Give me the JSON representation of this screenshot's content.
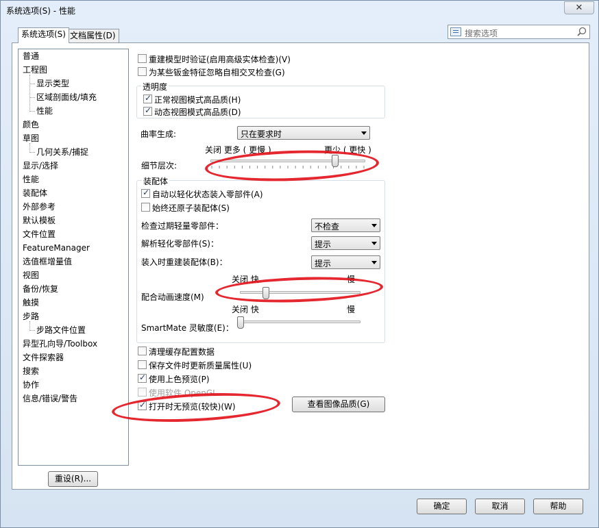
{
  "window": {
    "title": "系统选项(S) - 性能",
    "close": "✕"
  },
  "tabs": {
    "system": "系统选项(S)",
    "document": "文档属性(D)"
  },
  "search": {
    "placeholder": "搜索选项"
  },
  "tree": {
    "items": [
      {
        "label": "普通",
        "level": 0
      },
      {
        "label": "工程图",
        "level": 0
      },
      {
        "label": "显示类型",
        "level": 1
      },
      {
        "label": "区域剖面线/填充",
        "level": 1
      },
      {
        "label": "性能",
        "level": 1
      },
      {
        "label": "颜色",
        "level": 0
      },
      {
        "label": "草图",
        "level": 0
      },
      {
        "label": "几何关系/捕捉",
        "level": 1
      },
      {
        "label": "显示/选择",
        "level": 0
      },
      {
        "label": "性能",
        "level": 0
      },
      {
        "label": "装配体",
        "level": 0
      },
      {
        "label": "外部参考",
        "level": 0
      },
      {
        "label": "默认模板",
        "level": 0
      },
      {
        "label": "文件位置",
        "level": 0
      },
      {
        "label": "FeatureManager",
        "level": 0
      },
      {
        "label": "选值框增量值",
        "level": 0
      },
      {
        "label": "视图",
        "level": 0
      },
      {
        "label": "备份/恢复",
        "level": 0
      },
      {
        "label": "触摸",
        "level": 0
      },
      {
        "label": "步路",
        "level": 0
      },
      {
        "label": "步路文件位置",
        "level": 1
      },
      {
        "label": "异型孔向导/Toolbox",
        "level": 0
      },
      {
        "label": "文件探索器",
        "level": 0
      },
      {
        "label": "搜索",
        "level": 0
      },
      {
        "label": "协作",
        "level": 0
      },
      {
        "label": "信息/错误/警告",
        "level": 0
      }
    ]
  },
  "reset_button": "重设(R)...",
  "options": {
    "rebuild_verify": "重建模型时验证(启用高级实体检查)(V)",
    "ignore_sheetmetal": "为某些钣金特征忽略自相交叉检查(G)",
    "transparency_title": "透明度",
    "normal_view_hq": "正常视图模式高品质(H)",
    "dynamic_view_hq": "动态视图模式高品质(D)",
    "curvature_label": "曲率生成:",
    "curvature_value": "只在要求时",
    "lod_off_more": "关闭 更多 ( 更慢 )",
    "lod_less": "更少 ( 更快 )",
    "lod_label": "细节层次:",
    "lod_level": 0.82,
    "assembly_title": "装配体",
    "auto_lightweight": "自动以轻化状态装入零部件(A)",
    "always_resolve": "始终还原子装配体(S)",
    "check_outdated_label": "检查过期轻量零部件：",
    "check_outdated_value": "不检查",
    "resolve_lightweight_label": "解析轻化零部件(S)：",
    "resolve_lightweight_value": "提示",
    "rebuild_on_load_label": "装入时重建装配体(B)：",
    "rebuild_on_load_value": "提示",
    "mate_anim_off_fast": "关闭  快",
    "mate_anim_slow": "慢",
    "mate_anim_label": "配合动画速度(M)",
    "mate_anim_level": 0.2,
    "smartmate_off_fast": "关闭  快",
    "smartmate_slow": "慢",
    "smartmate_label": "SmartMate 灵敏度(E)：",
    "smartmate_level": 0.0,
    "purge_cache": "清理缓存配置数据",
    "update_mass_props": "保存文件时更新质量属性(U)",
    "shaded_preview": "使用上色预览(P)",
    "software_opengl": "使用软件 OpenGL",
    "no_preview_open": "打开时无预览(较快)(W)",
    "view_image_quality": "查看图像品质(G)"
  },
  "buttons": {
    "ok": "确定",
    "cancel": "取消",
    "help": "帮助"
  },
  "colors": {
    "annotation": "#e2101a",
    "window_bg": "#dfe9f5"
  }
}
